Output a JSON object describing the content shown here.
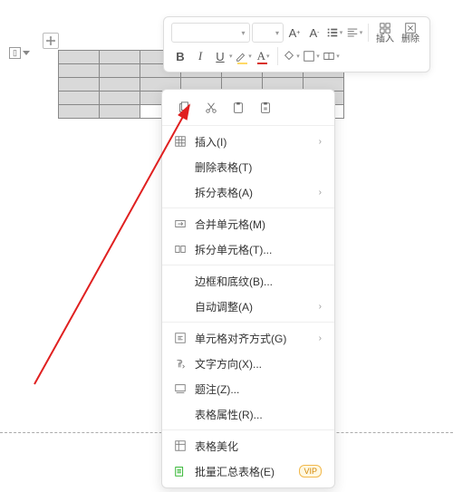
{
  "toolbar": {
    "font_name_placeholder": "",
    "font_size_placeholder": "",
    "bold": "B",
    "italic": "I",
    "underline": "U",
    "insert_label": "插入",
    "delete_label": "删除"
  },
  "clipboard": {
    "copy": "copy-icon",
    "cut": "cut-icon",
    "paste": "paste-icon",
    "paste_plain": "paste-plain-icon"
  },
  "menu": {
    "insert": "插入(I)",
    "delete_table": "删除表格(T)",
    "split_table": "拆分表格(A)",
    "merge_cells": "合并单元格(M)",
    "split_cells": "拆分单元格(T)...",
    "border_shading": "边框和底纹(B)...",
    "autofit": "自动调整(A)",
    "cell_alignment": "单元格对齐方式(G)",
    "text_direction": "文字方向(X)...",
    "caption": "题注(Z)...",
    "table_properties": "表格属性(R)...",
    "table_style": "表格美化",
    "batch_summary": "批量汇总表格(E)",
    "vip_badge": "VIP"
  },
  "table": {
    "rows": 5,
    "cols": 7
  }
}
